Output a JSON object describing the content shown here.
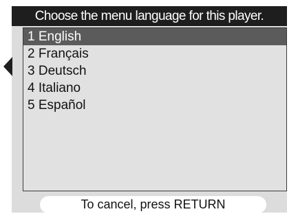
{
  "header": {
    "prompt": "Choose the menu language for this player."
  },
  "menu": {
    "selected_index": 0,
    "items": [
      {
        "label": "1 English"
      },
      {
        "label": "2 Français"
      },
      {
        "label": "3 Deutsch"
      },
      {
        "label": "4 Italiano"
      },
      {
        "label": "5 Español"
      }
    ]
  },
  "pointer": {
    "icon": "left-pointer-icon"
  },
  "footer": {
    "hint": "To cancel, press RETURN"
  },
  "colors": {
    "screen_background": "#dcdcdc",
    "header_background": "#1e1e1e",
    "selection_background": "#5b5b5b",
    "text": "#111111"
  }
}
